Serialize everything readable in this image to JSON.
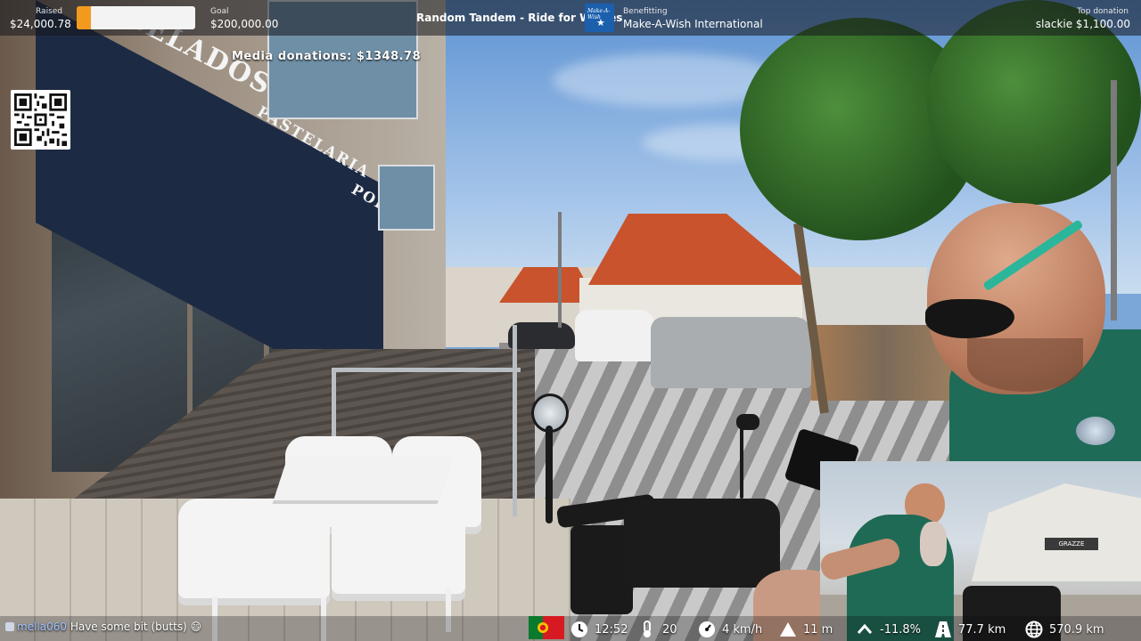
{
  "header": {
    "raised_label": "Raised",
    "raised_value": "$24,000.78",
    "goal_label": "Goal",
    "goal_value": "$200,000.00",
    "progress_fraction": 0.12,
    "stream_title": "Random Tandem - Ride for Wishes",
    "benefitting_label": "Benefitting",
    "benefitting_value": "Make-A-Wish International",
    "logo_text": "Make-A-Wish",
    "top_donation_label": "Top donation",
    "top_donation_value": "slackie $1,100.00"
  },
  "overlay": {
    "media_donations": "Media donations: $1348.78"
  },
  "storefront": {
    "sign_1": "GELADOS",
    "sign_2": "PASTELARIA",
    "sign_3": "POPS"
  },
  "chat": {
    "username": "mella060",
    "message": "Have some bit (butts) 😄"
  },
  "stats": {
    "time": "12:52",
    "temperature": "20",
    "speed": "4 km/h",
    "elevation": "11 m",
    "grade": "-11.8%",
    "distance_today": "77.7 km",
    "distance_total": "570.9 km"
  },
  "inset": {
    "shop_sign": "GRAZZE"
  },
  "colors": {
    "progress_fill": "#f39a1e",
    "topbar_bg": "rgba(20,22,28,0.55)",
    "logo_blue": "#1b5fad",
    "username": "#9ec3ff"
  },
  "icons": [
    "qr-code-icon",
    "portugal-flag-icon",
    "clock-icon",
    "thermometer-icon",
    "speedometer-icon",
    "mountain-icon",
    "chevron-up-icon",
    "road-icon",
    "globe-icon",
    "chat-user-icon"
  ]
}
